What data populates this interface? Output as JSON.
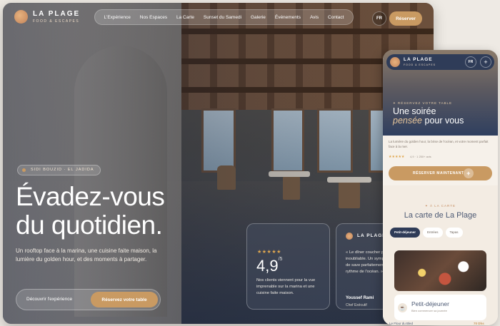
{
  "desktop": {
    "brand": "LA PLAGE",
    "brand_sub": "FOOD & ESCAPES",
    "nav": [
      "L'Expérience",
      "Nos Espaces",
      "La Carte",
      "Sunset du Samedi",
      "Galerie",
      "Événements",
      "Avis",
      "Contact"
    ],
    "lang": "FR",
    "reserve_label": "Réserver",
    "location": "SIDI BOUZID · EL JADIDA",
    "headline_line1": "Évadez-vous",
    "headline_line2": "du quotidien.",
    "lead": "Un rooftop face à la marina, une cuisine faite maison, la lumière du golden hour, et des moments à partager.",
    "cta_discover": "Découvrir l'expérience",
    "cta_book": "Réservez votre table",
    "rating_card": {
      "stars": "★★★★★",
      "rating": "4,9",
      "rating_sup": "/5",
      "text": "Nos clients viennent pour la vue imprenable sur la marina et une cuisine faite maison."
    },
    "quote_card": {
      "brand": "LA PLAGE",
      "quote": "« Le dîner coucher plus inoubliable. Un symphonie de save parfaitement acco rythme de l'océan. »",
      "name": "Youssef Rami",
      "role": "Chef Exécutif"
    }
  },
  "mobile": {
    "brand": "LA PLAGE",
    "brand_sub": "FOOD & ESCAPES",
    "lang": "FR",
    "plus": "+",
    "kicker": "✦ RÉSERVEZ VOTRE TABLE",
    "headline_a": "Une soirée",
    "headline_b_italic": "pensée",
    "headline_b_rest": " pour vous",
    "desc": "La lumière du golden hour, la brise de l'océan, et votre moment parfait face à la mer.",
    "stars": "★★★★★",
    "mini": "4,9 · 1 250+ avis",
    "book_label": "RÉSERVER MAINTENANT",
    "book_icon": "+",
    "menu_kicker": "✦ À LA CARTE",
    "menu_title": "La carte de La Plage",
    "tabs": [
      "Petit-déjeuner",
      "Entrées",
      "Tapas"
    ],
    "item_title": "Petit-déjeuner",
    "item_sub": "Bien commencer sa journée",
    "footer_item": "Le Flour du Bled",
    "footer_price": "70 Dhs"
  }
}
